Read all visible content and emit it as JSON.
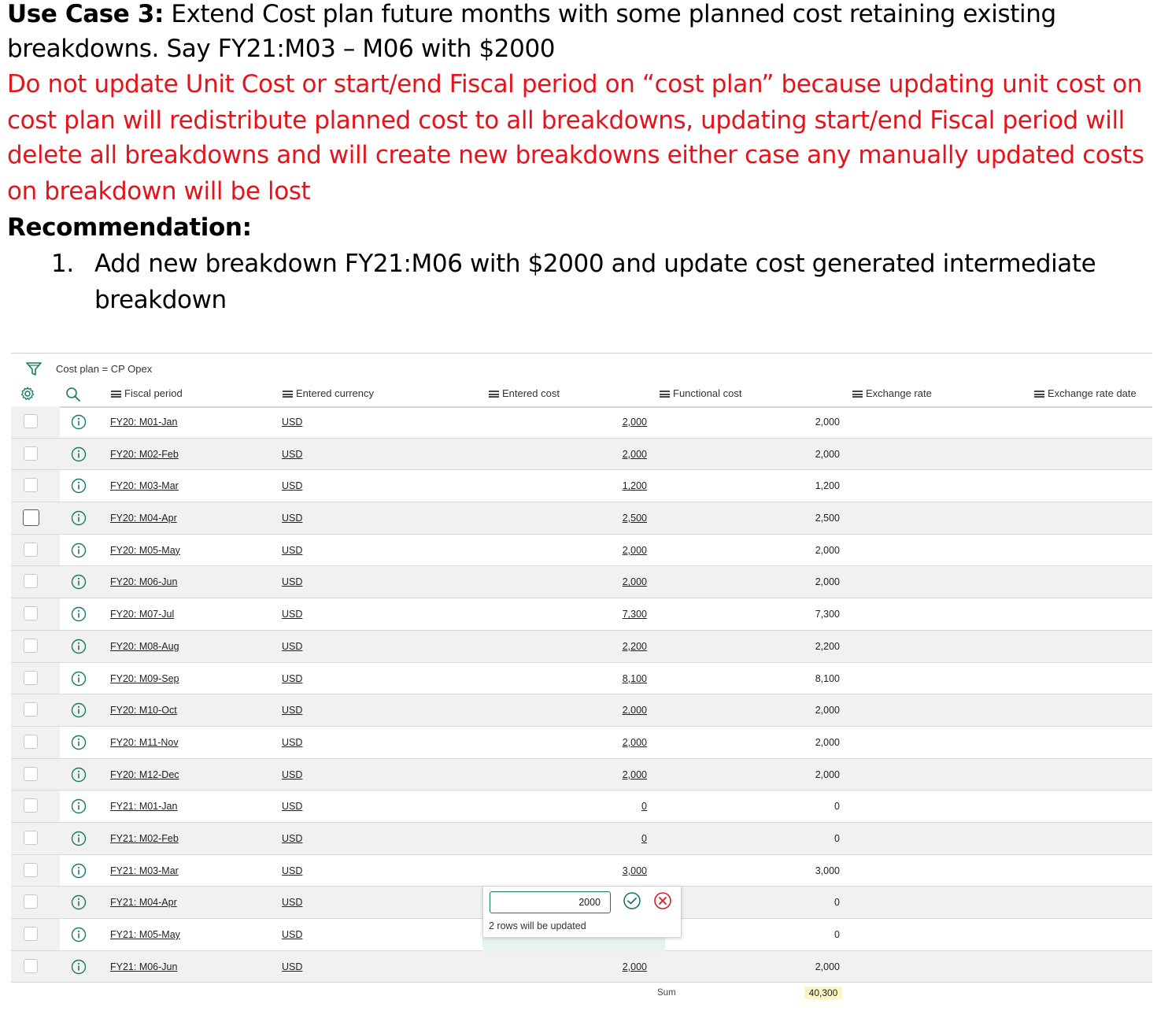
{
  "heading": {
    "label": "Use Case 3:",
    "text_l1": " Extend Cost plan future months with some planned cost retaining existing",
    "text_l2": "breakdowns. Say FY21:M03 – M06 with $2000"
  },
  "warning": {
    "line1": "Do not update Unit Cost or start/end Fiscal period on “cost plan” because updating unit cost on",
    "line2": "cost plan will redistribute planned cost to all breakdowns, updating start/end Fiscal period will",
    "line3": "delete all breakdowns and will create new breakdowns either case any manually updated costs",
    "line4": "on breakdown will be lost"
  },
  "recommendation": {
    "title": "Recommendation:",
    "item_number": "1.",
    "item_line1": "Add new breakdown FY21:M06 with $2000 and update cost generated intermediate",
    "item_line2": "breakdown"
  },
  "grid": {
    "filter": "Cost plan = CP Opex",
    "columns": {
      "fiscal_period": "Fiscal period",
      "entered_currency": "Entered currency",
      "entered_cost": "Entered cost",
      "functional_cost": "Functional cost",
      "exchange_rate": "Exchange rate",
      "exchange_rate_date": "Exchange rate date"
    },
    "rows": [
      {
        "period": "FY20: M01-Jan",
        "currency": "USD",
        "entered": "2,000",
        "functional": "2,000"
      },
      {
        "period": "FY20: M02-Feb",
        "currency": "USD",
        "entered": "2,000",
        "functional": "2,000"
      },
      {
        "period": "FY20: M03-Mar",
        "currency": "USD",
        "entered": "1,200",
        "functional": "1,200"
      },
      {
        "period": "FY20: M04-Apr",
        "currency": "USD",
        "entered": "2,500",
        "functional": "2,500"
      },
      {
        "period": "FY20: M05-May",
        "currency": "USD",
        "entered": "2,000",
        "functional": "2,000"
      },
      {
        "period": "FY20: M06-Jun",
        "currency": "USD",
        "entered": "2,000",
        "functional": "2,000"
      },
      {
        "period": "FY20: M07-Jul",
        "currency": "USD",
        "entered": "7,300",
        "functional": "7,300"
      },
      {
        "period": "FY20: M08-Aug",
        "currency": "USD",
        "entered": "2,200",
        "functional": "2,200"
      },
      {
        "period": "FY20: M09-Sep",
        "currency": "USD",
        "entered": "8,100",
        "functional": "8,100"
      },
      {
        "period": "FY20: M10-Oct",
        "currency": "USD",
        "entered": "2,000",
        "functional": "2,000"
      },
      {
        "period": "FY20: M11-Nov",
        "currency": "USD",
        "entered": "2,000",
        "functional": "2,000"
      },
      {
        "period": "FY20: M12-Dec",
        "currency": "USD",
        "entered": "2,000",
        "functional": "2,000"
      },
      {
        "period": "FY21: M01-Jan",
        "currency": "USD",
        "entered": "0",
        "functional": "0"
      },
      {
        "period": "FY21: M02-Feb",
        "currency": "USD",
        "entered": "0",
        "functional": "0"
      },
      {
        "period": "FY21: M03-Mar",
        "currency": "USD",
        "entered": "3,000",
        "functional": "3,000"
      },
      {
        "period": "FY21: M04-Apr",
        "currency": "USD",
        "entered": "",
        "functional": "0"
      },
      {
        "period": "FY21: M05-May",
        "currency": "USD",
        "entered": "",
        "functional": "0"
      },
      {
        "period": "FY21: M06-Jun",
        "currency": "USD",
        "entered": "2,000",
        "functional": "2,000"
      }
    ],
    "sum_label": "Sum",
    "sum_value": "40,300",
    "editor": {
      "value": "2000",
      "message": "2 rows will be updated"
    }
  },
  "colors": {
    "warning": "#e3141b",
    "accent": "#1a7a5e",
    "cancel": "#d0202a",
    "sum_highlight": "#fbf6c4"
  }
}
